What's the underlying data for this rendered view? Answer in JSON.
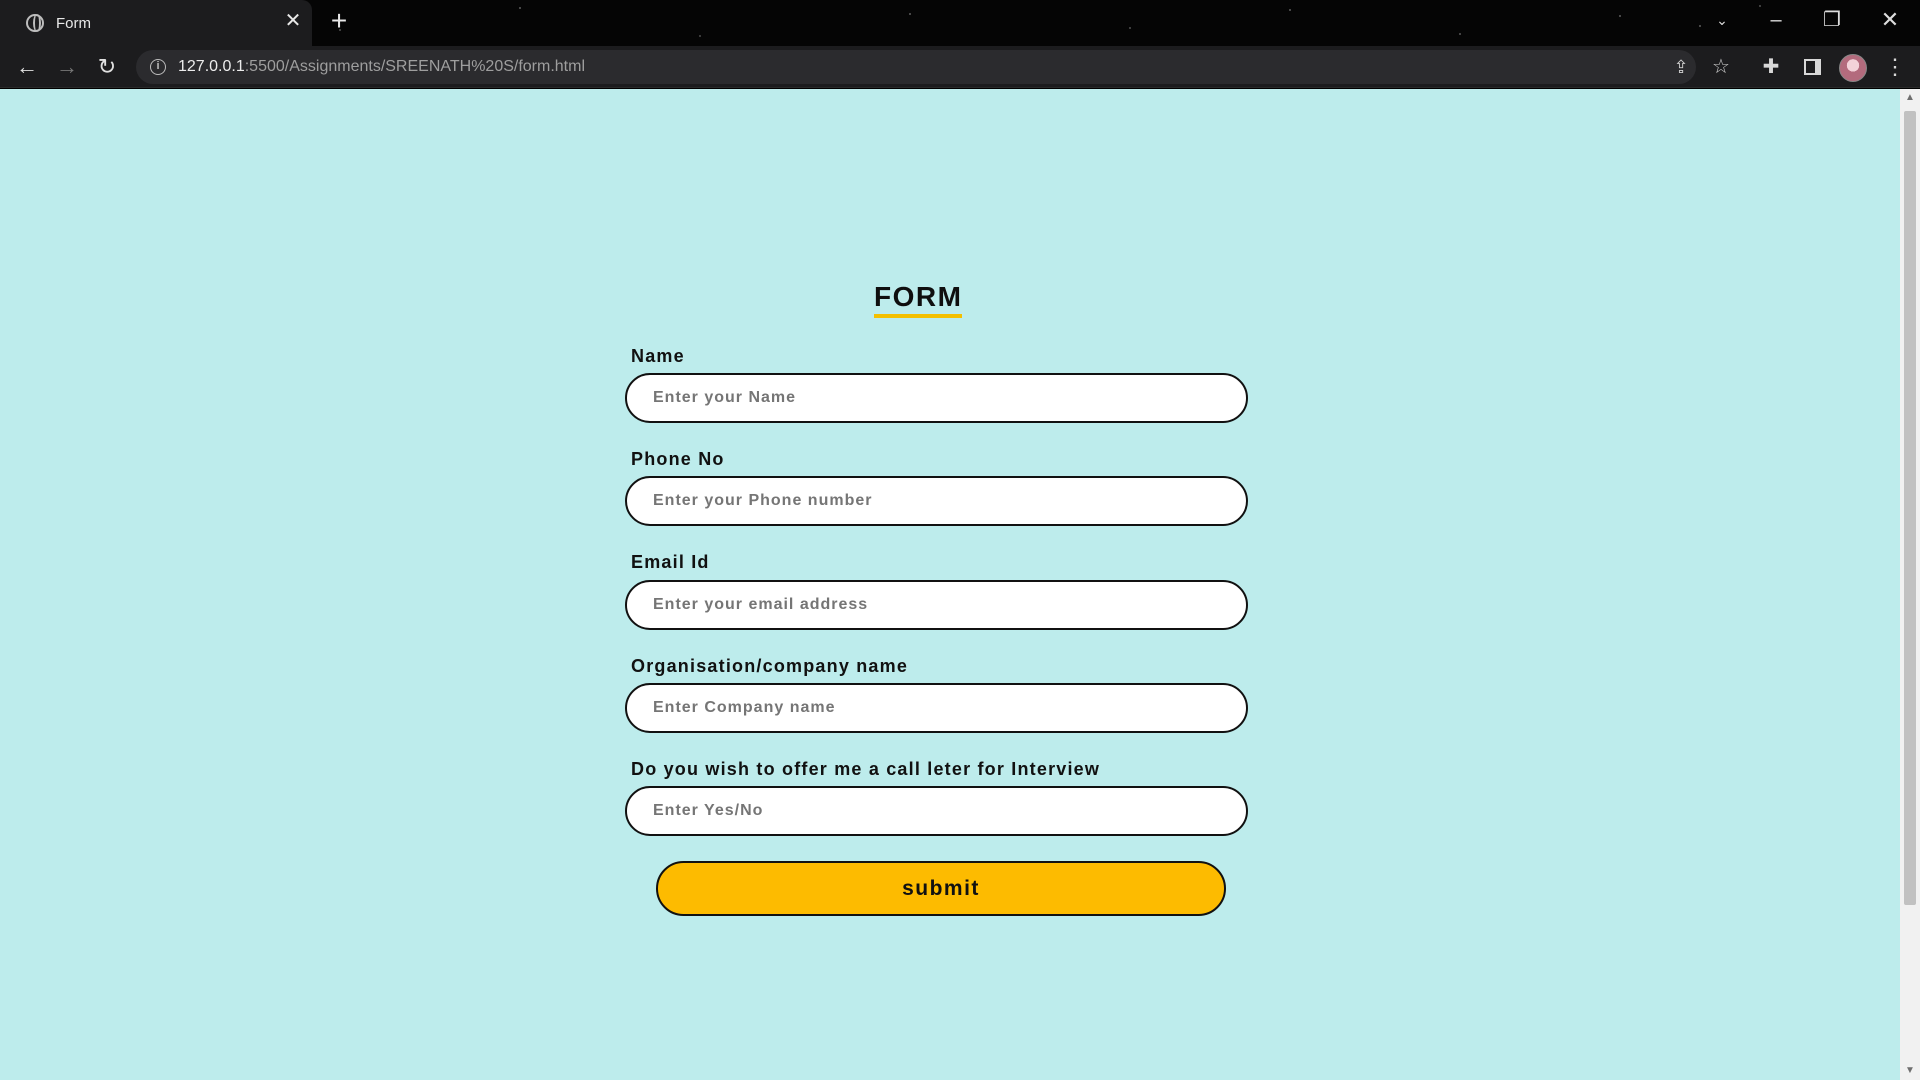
{
  "browser": {
    "tab_title": "Form",
    "tab_close": "✕",
    "new_tab": "+",
    "url_host": "127.0.0.1",
    "url_rest": ":5500/Assignments/SREENATH%20S/form.html"
  },
  "form": {
    "title": "FORM",
    "fields": [
      {
        "label": "Name",
        "placeholder": "Enter your Name"
      },
      {
        "label": "Phone No",
        "placeholder": "Enter your Phone number"
      },
      {
        "label": "Email Id",
        "placeholder": "Enter your email address"
      },
      {
        "label": "Organisation/company name",
        "placeholder": "Enter Company name"
      },
      {
        "label": "Do you wish to offer me a call leter for Interview",
        "placeholder": "Enter Yes/No"
      }
    ],
    "submit_label": "submit"
  },
  "colors": {
    "page_background": "#bdecec",
    "accent": "#fdbb00",
    "title_underline": "#f4c000"
  }
}
